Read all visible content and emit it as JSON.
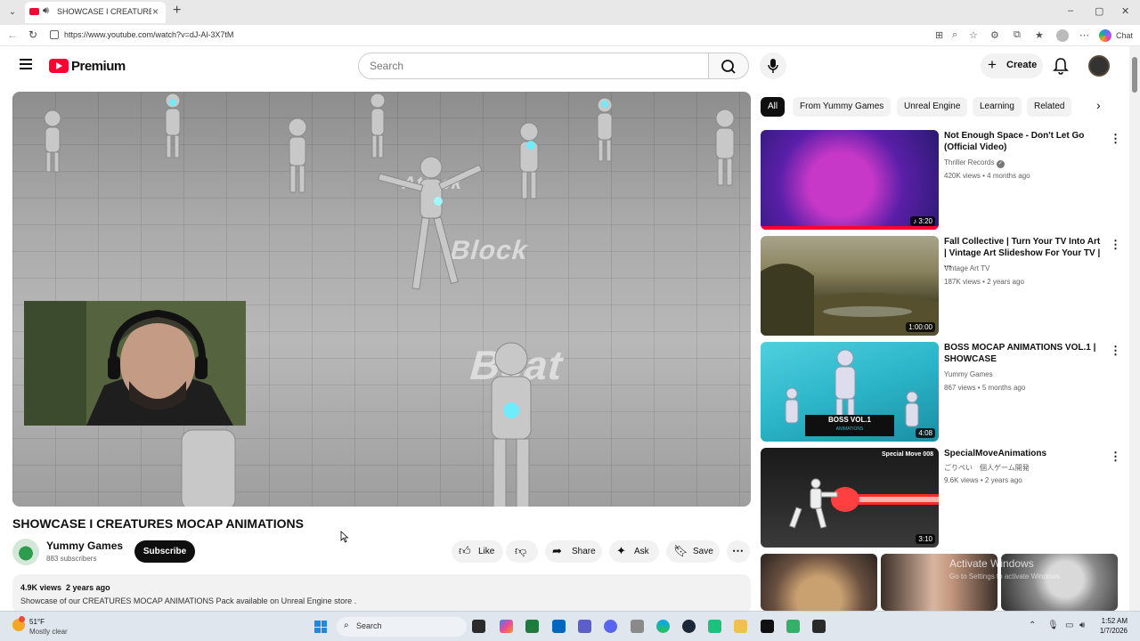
{
  "browser": {
    "tab_title": "SHOWCASE I CREATURES MO",
    "url": "https://www.youtube.com/watch?v=dJ-Al-3X7tM",
    "chat_label": "Chat"
  },
  "header": {
    "logo_text": "Premium",
    "search_placeholder": "Search",
    "create_label": "Create"
  },
  "player": {
    "floor_words": [
      "Attack",
      "Block",
      "Beat"
    ]
  },
  "video": {
    "title": "SHOWCASE I CREATURES MOCAP ANIMATIONS",
    "channel": "Yummy Games",
    "subscribers": "883 subscribers",
    "subscribe_label": "Subscribe",
    "like_label": "Like",
    "share_label": "Share",
    "ask_label": "Ask",
    "save_label": "Save",
    "views": "4.9K views",
    "age": "2 years ago",
    "description": "Showcase of our CREATURES MOCAP ANIMATIONS Pack available on Unreal Engine store ."
  },
  "chips": [
    "All",
    "From Yummy Games",
    "Unreal Engine",
    "Learning",
    "Related"
  ],
  "recommendations": [
    {
      "title": "Not Enough Space - Don't Let Go (Official Video)",
      "channel": "Thriller Records",
      "verified": true,
      "meta": "420K views • 4 months ago",
      "duration": "3:20",
      "thumb_color": "#6a1fb0"
    },
    {
      "title": "Fall Collective | Turn Your TV Into Art | Vintage Art Slideshow For Your TV | ...",
      "channel": "Vintage Art TV",
      "verified": false,
      "meta": "187K views • 2 years ago",
      "duration": "1:00:00",
      "thumb_color": "#6b6340"
    },
    {
      "title": "BOSS MOCAP ANIMATIONS VOL.1 | SHOWCASE",
      "channel": "Yummy Games",
      "verified": false,
      "meta": "867 views • 5 months ago",
      "duration": "4:08",
      "thumb_color": "#2bb5c9",
      "thumb_text": "BOSS VOL.1",
      "thumb_sub": "ANIMATIONS"
    },
    {
      "title": "SpecialMoveAnimations",
      "channel": "ごりぺい　個人ゲーム開発",
      "verified": false,
      "meta": "9.6K views • 2 years ago",
      "duration": "3:10",
      "thumb_color": "#222222",
      "thumb_text": "Special Move 008"
    }
  ],
  "watermark": {
    "title": "Activate Windows",
    "subtitle": "Go to Settings to activate Windows."
  },
  "taskbar": {
    "temperature": "51°F",
    "weather": "Mostly clear",
    "search_label": "Search",
    "time": "1:52 AM",
    "date": "1/7/2026"
  }
}
